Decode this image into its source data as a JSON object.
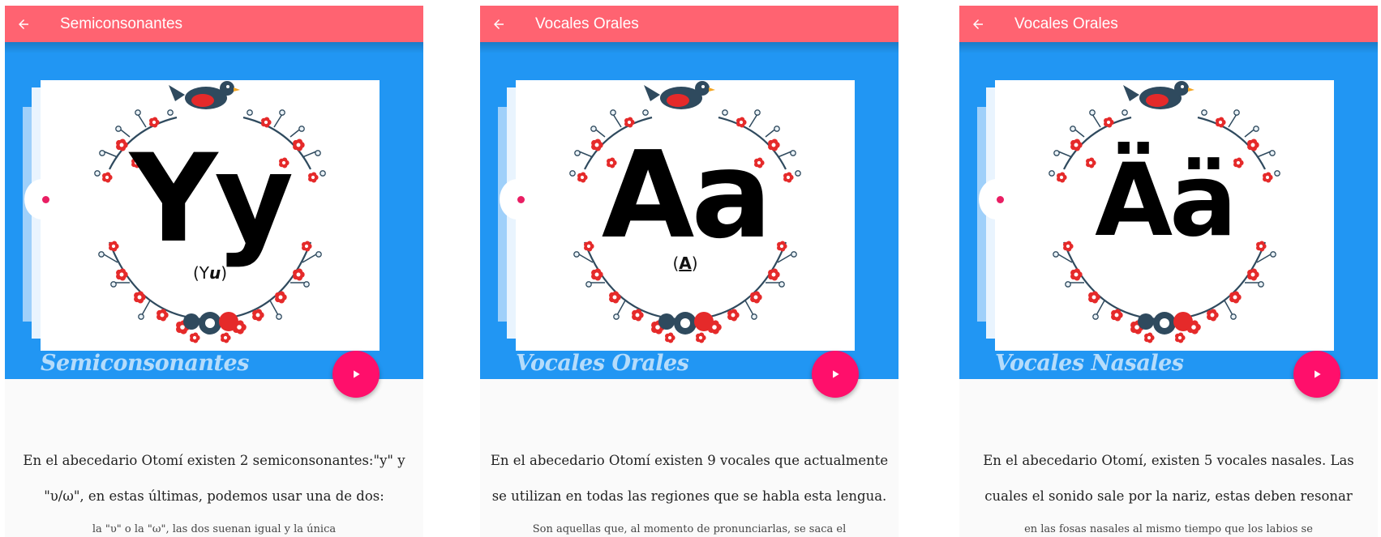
{
  "screens": [
    {
      "appbar_title": "Semiconsonantes",
      "letter": "Yy",
      "pronunciation_prefix": "(Y",
      "pronunciation_emph": "u",
      "pronunciation_suffix": ")",
      "section_title": "Semiconsonantes",
      "description_lines": [
        "En el abecedario Otomí existen 2 semiconsonantes:\"y\" y",
        "\"υ/ω\", en estas últimas, podemos usar una de dos:",
        "la \"υ\" o la \"ω\", las dos suenan igual y la única"
      ]
    },
    {
      "appbar_title": "Vocales Orales",
      "letter": "Aa",
      "pronunciation_prefix": "(",
      "pronunciation_emph": "A",
      "pronunciation_suffix": ")",
      "section_title": "Vocales Orales",
      "description_lines": [
        "En el abecedario Otomí existen 9 vocales que actualmente",
        "se utilizan en todas las regiones que se habla esta lengua.",
        "Son aquellas que, al momento de pronunciarlas, se saca el"
      ]
    },
    {
      "appbar_title": "Vocales Orales",
      "letter": "Ää",
      "pronunciation_prefix": "",
      "pronunciation_emph": "",
      "pronunciation_suffix": "",
      "section_title": "Vocales Nasales",
      "description_lines": [
        "En el abecedario Otomí, existen 5 vocales nasales. Las",
        "cuales el sonido sale por la nariz, estas deben resonar",
        "en las fosas nasales al mismo tiempo que los labios se"
      ]
    }
  ],
  "icons": {
    "back": "arrow-back-icon",
    "play": "play-icon",
    "bird": "bird-icon",
    "wreath": "floral-wreath"
  },
  "colors": {
    "appbar": "#ff6371",
    "hero": "#2196f3",
    "fab": "#ff0f6b",
    "wreath_red": "#e52a2a",
    "wreath_navy": "#2f4a5e"
  }
}
